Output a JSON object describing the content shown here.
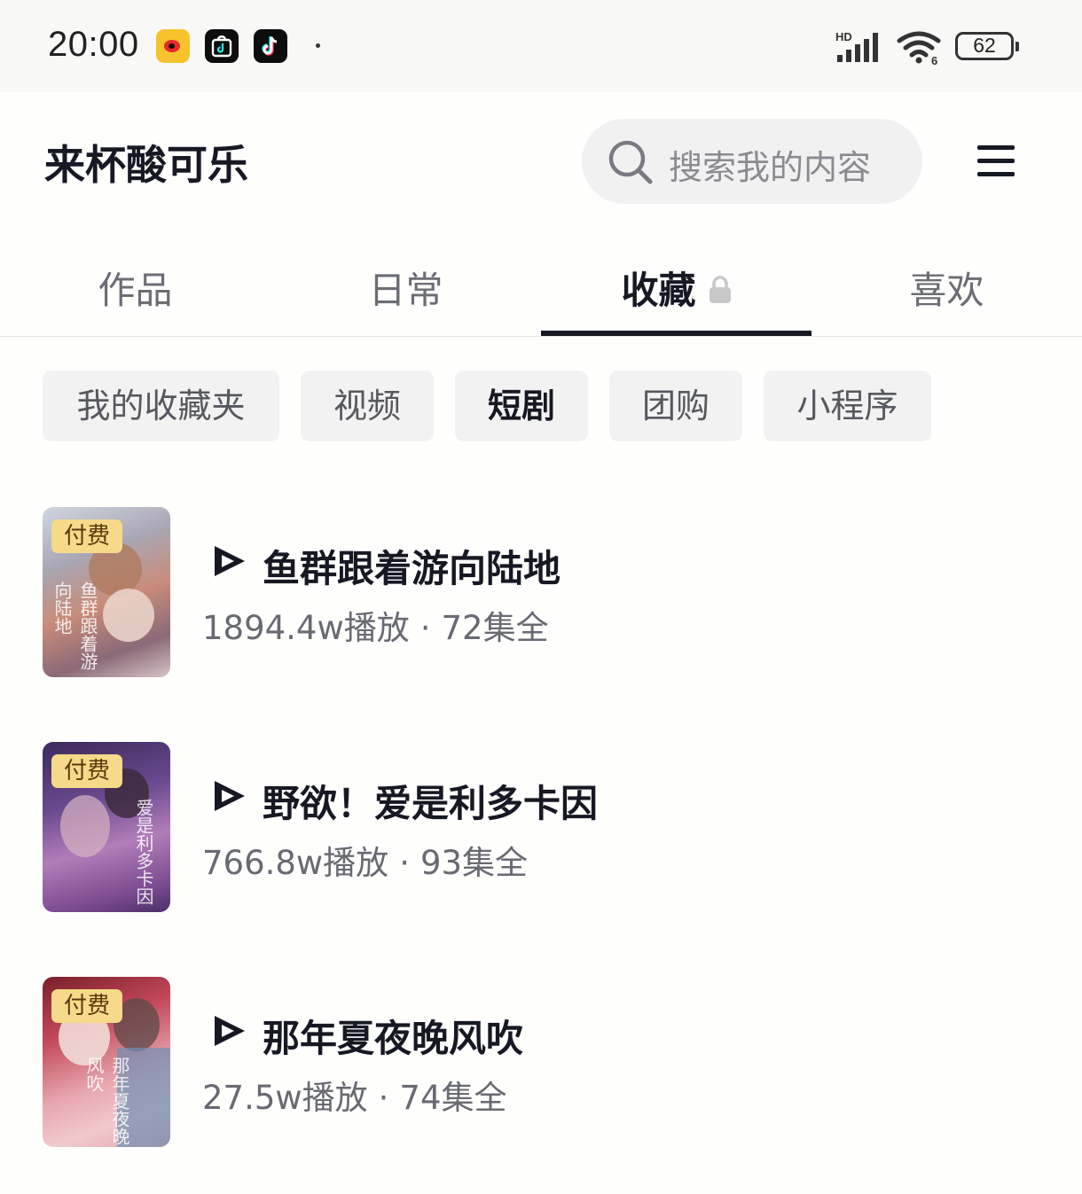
{
  "status_bar": {
    "time": "20:00",
    "battery": "62",
    "network_label": "HD",
    "notification_icons": [
      "weibo-icon",
      "tiktok-shop-icon",
      "tiktok-icon"
    ]
  },
  "header": {
    "profile_name": "来杯酸可乐",
    "search_placeholder": "搜索我的内容",
    "menu_icon": "hamburger-menu-icon"
  },
  "tabs": [
    {
      "label": "作品",
      "active": false
    },
    {
      "label": "日常",
      "active": false
    },
    {
      "label": "收藏",
      "active": true,
      "locked": true
    },
    {
      "label": "喜欢",
      "active": false
    }
  ],
  "chips": [
    {
      "label": "我的收藏夹",
      "active": false
    },
    {
      "label": "视频",
      "active": false
    },
    {
      "label": "短剧",
      "active": true
    },
    {
      "label": "团购",
      "active": false
    },
    {
      "label": "小程序",
      "active": false
    }
  ],
  "dramas": [
    {
      "badge": "付费",
      "poster_text": "鱼群跟着游向陆地",
      "title": "鱼群跟着游向陆地",
      "plays": "1894.4w播放",
      "episodes": "72集全"
    },
    {
      "badge": "付费",
      "poster_text": "爱是利多卡因",
      "title": "野欲！爱是利多卡因",
      "plays": "766.8w播放",
      "episodes": "93集全"
    },
    {
      "badge": "付费",
      "poster_text": "那年夏夜晚风吹",
      "title": "那年夏夜晚风吹",
      "plays": "27.5w播放",
      "episodes": "74集全"
    }
  ],
  "meta_separator": "·",
  "colors": {
    "text_primary": "#161823",
    "text_secondary": "#686a72",
    "chip_bg": "#f2f2f2",
    "paid_badge_bg": "#f7d98a"
  }
}
